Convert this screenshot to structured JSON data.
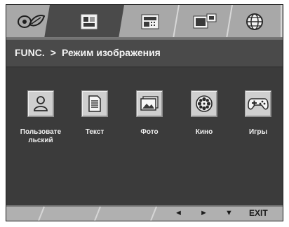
{
  "tabs": [
    {
      "name": "picture-quality"
    },
    {
      "name": "picture-mode",
      "active": true
    },
    {
      "name": "function"
    },
    {
      "name": "pip"
    },
    {
      "name": "language"
    }
  ],
  "header": {
    "section": "FUNC.",
    "separator": ">",
    "title": "Режим изображения"
  },
  "modes": [
    {
      "id": "user",
      "label_line1": "Пользовате",
      "label_line2": "льский",
      "icon": "person-icon"
    },
    {
      "id": "text",
      "label_line1": "Текст",
      "label_line2": "",
      "icon": "document-icon"
    },
    {
      "id": "photo",
      "label_line1": "Фото",
      "label_line2": "",
      "icon": "photo-icon"
    },
    {
      "id": "movie",
      "label_line1": "Кино",
      "label_line2": "",
      "icon": "film-reel-icon"
    },
    {
      "id": "game",
      "label_line1": "Игры",
      "label_line2": "",
      "icon": "gamepad-icon"
    }
  ],
  "footer": {
    "left": "◄",
    "right": "►",
    "down": "▼",
    "exit": "EXIT"
  },
  "colors": {
    "panel": "#3b3b3b",
    "tab_bar": "#a9a9a9",
    "active_tab": "#4a4a4a",
    "tile": "#cfcfcf"
  }
}
